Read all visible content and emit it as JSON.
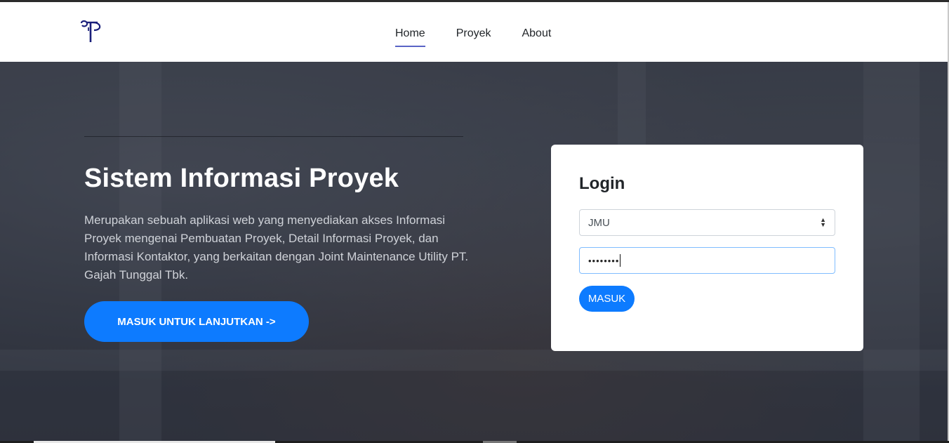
{
  "navbar": {
    "logo_name": "gt-monogram-logo",
    "links": [
      {
        "label": "Home",
        "active": true
      },
      {
        "label": "Proyek",
        "active": false
      },
      {
        "label": "About",
        "active": false
      }
    ]
  },
  "hero": {
    "title": "Sistem Informasi Proyek",
    "description": "Merupakan sebuah aplikasi web yang menyediakan akses Informasi Proyek mengenai Pembuatan Proyek, Detail Informasi Proyek, dan Informasi Kontaktor, yang berkaitan dengan Joint Maintenance Utility PT. Gajah Tunggal Tbk.",
    "cta_label": "MASUK UNTUK LANJUTKAN ->"
  },
  "login": {
    "title": "Login",
    "select_value": "JMU",
    "password_mask": "••••••••",
    "submit_label": "MASUK"
  },
  "colors": {
    "primary": "#0d7bff",
    "nav_underline": "#5a63c6",
    "navbar_bg": "#ffffff",
    "hero_overlay": "#3a3e49"
  }
}
